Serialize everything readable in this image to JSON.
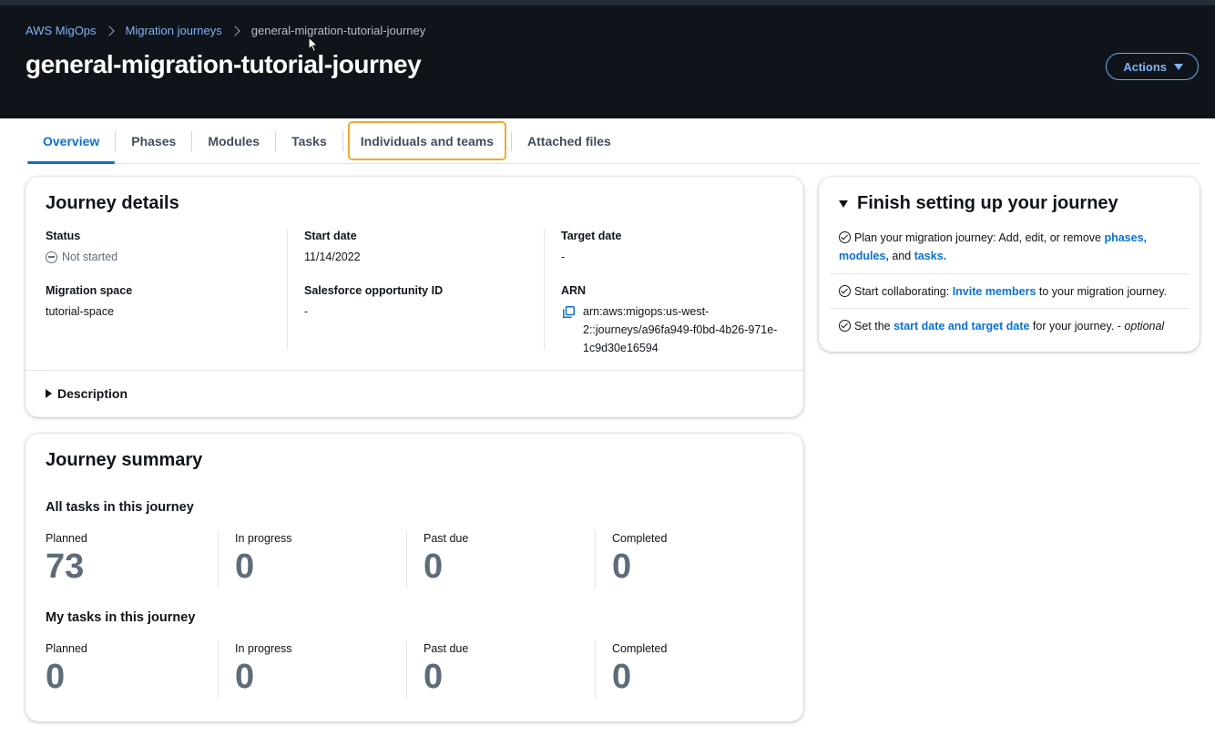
{
  "breadcrumb": {
    "items": [
      "AWS MigOps",
      "Migration journeys"
    ],
    "current": "general-migration-tutorial-journey"
  },
  "header": {
    "title": "general-migration-tutorial-journey",
    "actions_label": "Actions"
  },
  "tabs": [
    {
      "label": "Overview",
      "active": true
    },
    {
      "label": "Phases"
    },
    {
      "label": "Modules"
    },
    {
      "label": "Tasks"
    },
    {
      "label": "Individuals and teams",
      "highlighted": true
    },
    {
      "label": "Attached files"
    }
  ],
  "journey_details": {
    "title": "Journey details",
    "status_label": "Status",
    "status_value": "Not started",
    "migration_space_label": "Migration space",
    "migration_space_value": "tutorial-space",
    "start_date_label": "Start date",
    "start_date_value": "11/14/2022",
    "salesforce_label": "Salesforce opportunity ID",
    "salesforce_value": "-",
    "target_date_label": "Target date",
    "target_date_value": "-",
    "arn_label": "ARN",
    "arn_value": "arn:aws:migops:us-west-2::journeys/a96fa949-f0bd-4b26-971e-1c9d30e16594",
    "description_label": "Description"
  },
  "journey_summary": {
    "title": "Journey summary",
    "all_tasks": {
      "title": "All tasks in this journey",
      "planned_label": "Planned",
      "planned": "73",
      "in_progress_label": "In progress",
      "in_progress": "0",
      "past_due_label": "Past due",
      "past_due": "0",
      "completed_label": "Completed",
      "completed": "0"
    },
    "my_tasks": {
      "title": "My tasks in this journey",
      "planned_label": "Planned",
      "planned": "0",
      "in_progress_label": "In progress",
      "in_progress": "0",
      "past_due_label": "Past due",
      "past_due": "0",
      "completed_label": "Completed",
      "completed": "0"
    }
  },
  "setup": {
    "title": "Finish setting up your journey",
    "item1": {
      "text_before": "Plan your migration journey: Add, edit, or remove ",
      "link_phases": "phases,",
      "link_modules": "modules,",
      "text_and": " and ",
      "link_tasks": "tasks."
    },
    "item2": {
      "text_before": "Start collaborating: ",
      "link": "Invite members",
      "text_after": " to your migration journey."
    },
    "item3": {
      "text_before": "Set the ",
      "link": "start date and target date",
      "text_after": " for your journey. - ",
      "optional": "optional"
    }
  },
  "colors": {
    "header_bg": "#0f141a",
    "link": "#0972d3",
    "breadcrumb_link": "#7fb3f0",
    "tab_highlight": "#f0ab2e",
    "muted": "#5f6b7a"
  }
}
